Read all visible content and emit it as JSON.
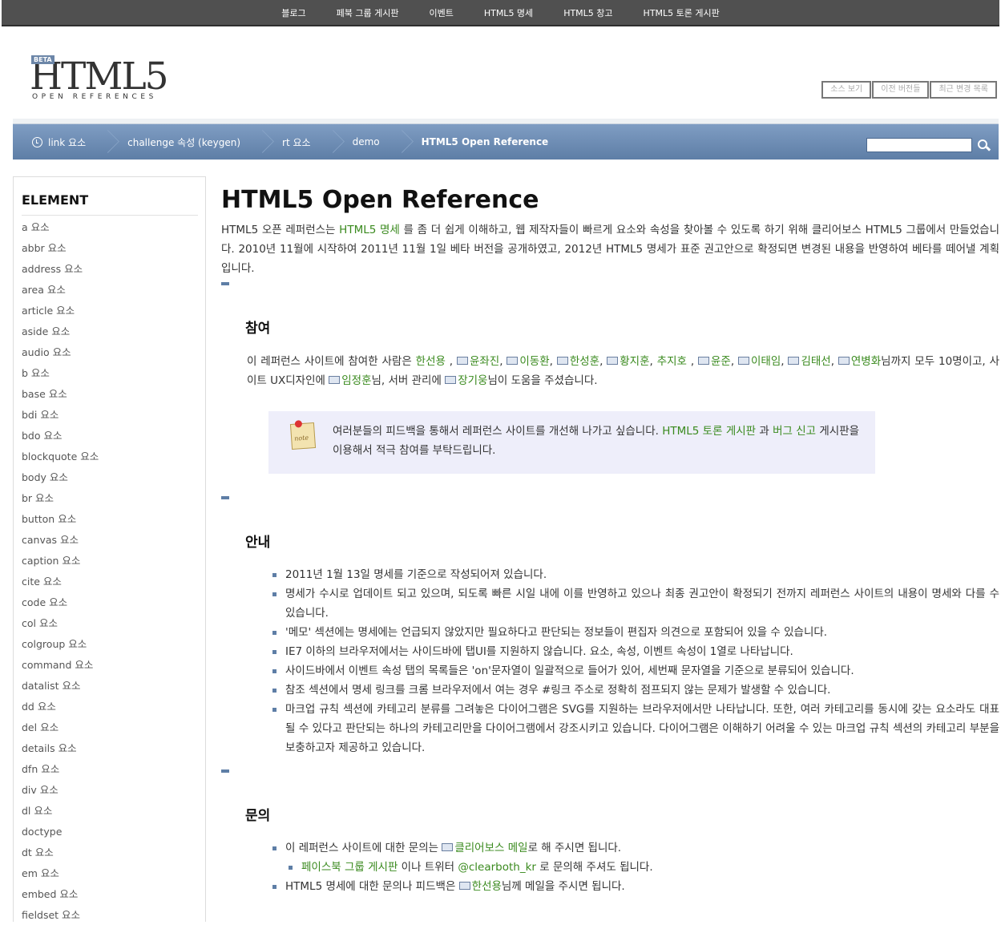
{
  "topnav": [
    "블로그",
    "페북 그룹 게시판",
    "이벤트",
    "HTML5 명세",
    "HTML5 창고",
    "HTML5 토론 게시판"
  ],
  "logo": {
    "beta": "BETA",
    "word": "HTML5",
    "sub": "OPEN REFERENCES"
  },
  "header_buttons": [
    "소스 보기",
    "이전 버전들",
    "최근 변경 목록"
  ],
  "breadcrumb": [
    "link 요소",
    "challenge 속성 (keygen)",
    "rt 요소",
    "demo",
    "HTML5 Open Reference"
  ],
  "search": {
    "placeholder": ""
  },
  "sidebar": {
    "title": "ELEMENT",
    "items": [
      "a 요소",
      "abbr 요소",
      "address 요소",
      "area 요소",
      "article 요소",
      "aside 요소",
      "audio 요소",
      "b 요소",
      "base 요소",
      "bdi 요소",
      "bdo 요소",
      "blockquote 요소",
      "body 요소",
      "br 요소",
      "button 요소",
      "canvas 요소",
      "caption 요소",
      "cite 요소",
      "code 요소",
      "col 요소",
      "colgroup 요소",
      "command 요소",
      "datalist 요소",
      "dd 요소",
      "del 요소",
      "details 요소",
      "dfn 요소",
      "div 요소",
      "dl 요소",
      "doctype",
      "dt 요소",
      "em 요소",
      "embed 요소",
      "fieldset 요소"
    ]
  },
  "main": {
    "title": "HTML5 Open Reference",
    "intro": {
      "p1": "HTML5 오픈 레퍼런스는 ",
      "link": "HTML5 명세",
      "p2": " 를 좀 더 쉽게 이해하고, 웹 제작자들이 빠르게 요소와 속성을 찾아볼 수 있도록 하기 위해 클리어보스 HTML5 그룹에서 만들었습니다. 2010년 11월에 시작하여 2011년 11월 1일 베타 버전을 공개하였고, 2012년 HTML5 명세가 표준 권고안으로 확정되면 변경된 내용을 반영하여 베타를 떼어낼 계획입니다."
    },
    "participation": {
      "heading": "참여",
      "p1": "이 레퍼런스 사이트에 참여한 사람은 ",
      "people": [
        "한선용",
        "윤좌진",
        "이동환",
        "한성훈",
        "황지훈",
        "추지호",
        "윤준",
        "이태임",
        "김태선",
        "연병화"
      ],
      "p2": "님까지 모두 10명이고, 사이트 UX디자인에 ",
      "designer": "임정훈",
      "p3": "님, 서버 관리에 ",
      "server": "장기웅",
      "p4": "님이 도움을 주셨습니다.",
      "note_icon_label": "note",
      "note1": "여러분들의 피드백을 통해서 레퍼런스 사이트를 개선해 나가고 싶습니다. ",
      "note_link1": "HTML5 토론 게시판",
      "note2": " 과 ",
      "note_link2": "버그 신고",
      "note3": " 게시판을 이용해서 적극 참여를 부탁드립니다."
    },
    "guide": {
      "heading": "안내",
      "items": [
        "2011년 1월 13일 명세를 기준으로 작성되어져 있습니다.",
        "명세가 수시로 업데이트 되고 있으며, 되도록 빠른 시일 내에 이를 반영하고 있으나 최종 권고안이 확정되기 전까지 레퍼런스 사이트의 내용이 명세와 다를 수 있습니다.",
        "'메모' 섹션에는 명세에는 언급되지 않았지만 필요하다고 판단되는 정보들이 편집자 의견으로 포함되어 있을 수 있습니다.",
        "IE7 이하의 브라우저에서는 사이드바에 탭UI를 지원하지 않습니다. 요소, 속성, 이벤트 속성이 1열로 나타납니다.",
        "사이드바에서 이벤트 속성 탭의 목록들은 'on'문자열이 일괄적으로 들어가 있어, 세번째 문자열을 기준으로 분류되어 있습니다.",
        "참조 섹션에서 명세 링크를 크롬 브라우저에서 여는 경우 #링크 주소로 정확히 점프되지 않는 문제가 발생할 수 있습니다.",
        "마크업 규칙 섹션에 카테고리 분류를 그려놓은 다이어그램은 SVG를 지원하는 브라우저에서만 나타납니다. 또한, 여러 카테고리를 동시에 갖는 요소라도 대표될 수 있다고 판단되는 하나의 카테고리만을 다이어그램에서 강조시키고 있습니다. 다이어그램은 이해하기 어려울 수 있는 마크업 규칙 섹션의 카테고리 부분을 보충하고자 제공하고 있습니다."
      ]
    },
    "contact": {
      "heading": "문의",
      "i1a": "이 레퍼런스 사이트에 대한 문의는 ",
      "i1link": "클리어보스 메일",
      "i1b": "로 해 주시면 됩니다.",
      "i2link": "페이스북 그룹 게시판",
      "i2a": " 이나 트위터 ",
      "i2link2": "@clearboth_kr",
      "i2b": " 로 문의해 주셔도 됩니다.",
      "i3a": "HTML5 명세에 대한 문의나 피드백은 ",
      "i3link": "한선용",
      "i3b": "님께 메일을 주시면 됩니다."
    }
  }
}
